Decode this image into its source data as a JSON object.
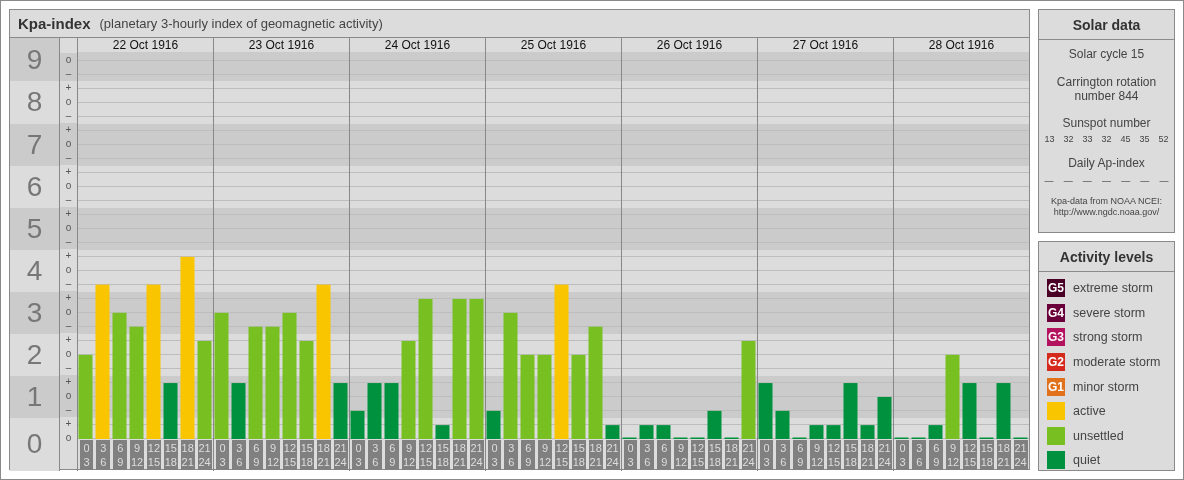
{
  "kpa_panel": {
    "title": "Kpa-index",
    "subtitle": "(planetary 3-hourly index of geomagnetic activity)",
    "dates": [
      "22 Oct 1916",
      "23 Oct 1916",
      "24 Oct 1916",
      "25 Oct 1916",
      "26 Oct 1916",
      "27 Oct 1916",
      "28 Oct 1916"
    ],
    "minor_tick_labels": [
      "o",
      "–",
      "+",
      "o",
      "–",
      "+",
      "o",
      "–",
      "+",
      "o",
      "–",
      "+",
      "o",
      "–",
      "+",
      "o",
      "–",
      "+",
      "o",
      "–",
      "+",
      "o",
      "–",
      "+",
      "o",
      "–",
      "+",
      "o"
    ],
    "slot_end_labels": [
      "3",
      "6",
      "9",
      "12",
      "15",
      "18",
      "21",
      "24",
      "3",
      "6",
      "9",
      "12",
      "15",
      "18",
      "21",
      "24",
      "3",
      "6",
      "9",
      "12",
      "15",
      "18",
      "21",
      "24",
      "3",
      "6",
      "9",
      "12",
      "15",
      "18",
      "21",
      "24",
      "3",
      "6",
      "9",
      "12",
      "15",
      "18",
      "21",
      "24",
      "3",
      "6",
      "9",
      "12",
      "15",
      "18",
      "21",
      "24",
      "3",
      "6",
      "9",
      "12",
      "15",
      "18",
      "21",
      "24"
    ],
    "chart_data": {
      "type": "bar",
      "ylim": [
        0,
        9.2
      ],
      "yticks": [
        {
          "value": 9,
          "label": "9"
        },
        {
          "value": 8,
          "label": "8"
        },
        {
          "value": 7,
          "label": "7"
        },
        {
          "value": 6,
          "label": "6"
        },
        {
          "value": 5,
          "label": "5"
        },
        {
          "value": 4,
          "label": "4"
        },
        {
          "value": 3,
          "label": "3"
        },
        {
          "value": 2,
          "label": "2"
        },
        {
          "value": 1,
          "label": "1"
        },
        {
          "value": 0,
          "label": "0"
        }
      ],
      "categories": [
        "0",
        "3",
        "6",
        "9",
        "12",
        "15",
        "18",
        "21",
        "0",
        "3",
        "6",
        "9",
        "12",
        "15",
        "18",
        "21",
        "0",
        "3",
        "6",
        "9",
        "12",
        "15",
        "18",
        "21",
        "0",
        "3",
        "6",
        "9",
        "12",
        "15",
        "18",
        "21",
        "0",
        "3",
        "6",
        "9",
        "12",
        "15",
        "18",
        "21",
        "0",
        "3",
        "6",
        "9",
        "12",
        "15",
        "18",
        "21",
        "0",
        "3",
        "6",
        "9",
        "12",
        "15",
        "18",
        "21"
      ],
      "series": [
        {
          "color": "#00913f",
          "values": [
            null,
            null,
            null,
            null,
            null,
            1.33,
            null,
            null,
            null,
            1.33,
            null,
            null,
            null,
            null,
            null,
            1.33,
            0.67,
            1.33,
            1.33,
            null,
            null,
            0.33,
            null,
            null,
            0.67,
            null,
            null,
            null,
            null,
            null,
            null,
            0.33,
            0,
            0.33,
            0.33,
            0,
            0,
            0.67,
            0,
            null,
            1.33,
            0.67,
            0,
            0.33,
            0.33,
            1.33,
            0.33,
            1.0,
            0,
            0,
            0.33,
            null,
            1.33,
            0,
            1.33,
            0
          ]
        },
        {
          "color": "#78c022",
          "values": [
            2.0,
            null,
            3.0,
            2.67,
            null,
            null,
            null,
            2.33,
            3.0,
            null,
            2.67,
            2.67,
            3.0,
            2.33,
            null,
            null,
            null,
            null,
            null,
            2.33,
            3.33,
            null,
            3.33,
            3.33,
            null,
            3.0,
            2.0,
            2.0,
            null,
            2.0,
            2.67,
            null,
            null,
            null,
            null,
            null,
            null,
            null,
            null,
            2.33,
            null,
            null,
            null,
            null,
            null,
            null,
            null,
            null,
            null,
            null,
            null,
            2.0,
            null,
            null,
            null,
            null
          ]
        },
        {
          "color": "#f9c500",
          "values": [
            null,
            3.67,
            null,
            null,
            3.67,
            null,
            4.33,
            null,
            null,
            null,
            null,
            null,
            null,
            null,
            3.67,
            null,
            null,
            null,
            null,
            null,
            null,
            null,
            null,
            null,
            null,
            null,
            null,
            null,
            3.67,
            null,
            null,
            null,
            null,
            null,
            null,
            null,
            null,
            null,
            null,
            null,
            null,
            null,
            null,
            null,
            null,
            null,
            null,
            null,
            null,
            null,
            null,
            null,
            null,
            null,
            null,
            null
          ]
        }
      ]
    }
  },
  "solar_data": {
    "title": "Solar data",
    "solar_cycle": "Solar cycle 15",
    "carrington_rotation": "Carrington rotation number 844",
    "sunspot_label": "Sunspot number",
    "sunspot_numbers": [
      "13",
      "32",
      "33",
      "32",
      "45",
      "35",
      "52"
    ],
    "ap_label": "Daily Ap-index",
    "ap_values": [
      "—",
      "—",
      "—",
      "—",
      "—",
      "—",
      "—"
    ],
    "source": "Kpa-data from NOAA NCEI:",
    "source_url": "http://www.ngdc.noaa.gov/"
  },
  "activity_levels": {
    "title": "Activity levels",
    "items": [
      {
        "badge": "G5",
        "label": "extreme storm",
        "color": "#4a0026"
      },
      {
        "badge": "G4",
        "label": "severe storm",
        "color": "#6a003a"
      },
      {
        "badge": "G3",
        "label": "strong storm",
        "color": "#b3125f"
      },
      {
        "badge": "G2",
        "label": "moderate storm",
        "color": "#d5291c"
      },
      {
        "badge": "G1",
        "label": "minor storm",
        "color": "#e2711c"
      },
      {
        "label": "active",
        "color": "#f9c500"
      },
      {
        "label": "unsettled",
        "color": "#78c022"
      },
      {
        "label": "quiet",
        "color": "#00913f"
      }
    ]
  }
}
